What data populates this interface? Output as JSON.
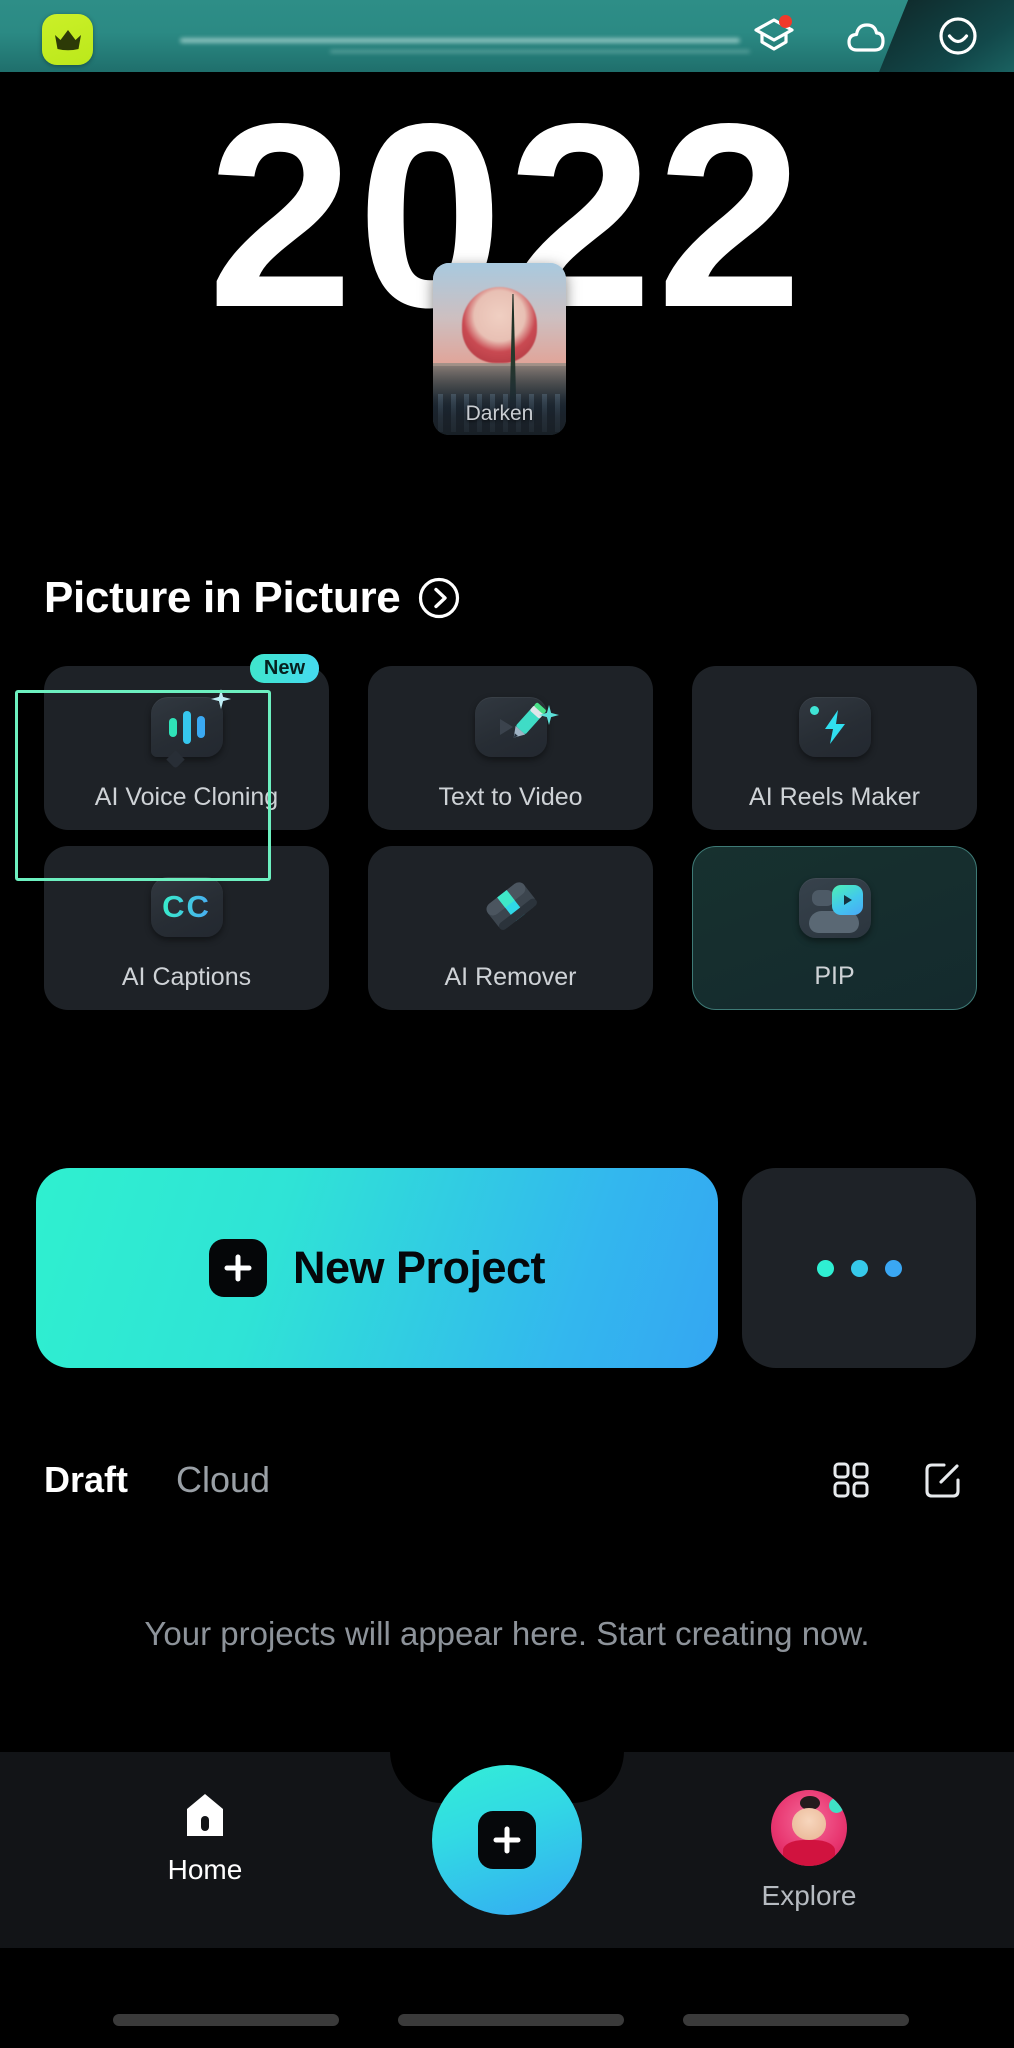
{
  "header": {
    "pro_badge": "crown-icon",
    "icons": [
      {
        "name": "tutorial-graduation-cap-icon",
        "has_badge": true
      },
      {
        "name": "cloud-icon",
        "has_badge": false
      },
      {
        "name": "profile-smiley-icon",
        "has_badge": false
      }
    ]
  },
  "hero": {
    "year": "2022",
    "thumbnail_label": "Darken"
  },
  "section": {
    "title": "Picture in Picture",
    "arrow_icon": "chevron-right-circle-icon"
  },
  "tools": [
    {
      "label": "AI Voice Cloning",
      "icon": "voice-waveform-bubble-icon",
      "badge": "New",
      "state": "normal"
    },
    {
      "label": "Text to Video",
      "icon": "pencil-play-icon",
      "badge": "",
      "state": "normal"
    },
    {
      "label": "AI Reels Maker",
      "icon": "lightning-bolt-icon",
      "badge": "",
      "state": "normal"
    },
    {
      "label": "AI Captions",
      "icon": "cc-icon",
      "badge": "",
      "state": "selected"
    },
    {
      "label": "AI Remover",
      "icon": "eraser-icon",
      "badge": "",
      "state": "normal"
    },
    {
      "label": "PIP",
      "icon": "picture-in-picture-icon",
      "badge": "",
      "state": "active"
    }
  ],
  "actions": {
    "new_project_label": "New Project",
    "new_project_icon": "plus-square-icon",
    "more_label": "",
    "more_icon": "three-dots-icon"
  },
  "projects": {
    "tabs": [
      {
        "label": "Draft",
        "active": true
      },
      {
        "label": "Cloud",
        "active": false
      }
    ],
    "grid_view_icon": "grid-view-icon",
    "edit_icon": "edit-square-icon",
    "empty_message": "Your projects will appear here. Start creating now."
  },
  "bottom_nav": {
    "home_label": "Home",
    "home_icon": "home-icon",
    "create_icon": "plus-icon",
    "explore_label": "Explore",
    "explore_icon": "explore-avatar-icon"
  },
  "colors": {
    "accent_teal": "#2ff0cf",
    "accent_blue": "#34a6f2",
    "selection_green": "#6df0c0",
    "badge_red": "#f0392b",
    "pro_lime": "#cbf028",
    "card_bg": "#1e2227"
  }
}
